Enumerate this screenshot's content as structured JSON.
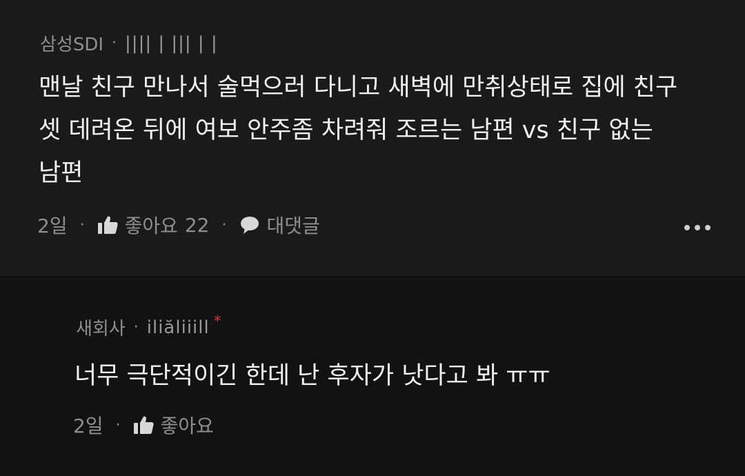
{
  "comment": {
    "author": "삼성SDI",
    "separator": "·",
    "handle": "|||| | ||| | |",
    "lines": [
      "맨날 친구 만나서 술먹으러 다니고 새벽에 만취상태로 집에 친구",
      "셋 데려온 뒤에 여보 안주좀 차려줘 조르는 남편 vs 친구 없는",
      "남편"
    ],
    "time": "2일",
    "like_label": "좋아요",
    "like_count": "22",
    "reply_label": "대댓글",
    "icons": {
      "like": "thumbs-up-icon",
      "reply": "speech-bubble-icon",
      "more": "more-dots-icon"
    }
  },
  "reply": {
    "author": "새회사",
    "separator": "·",
    "handle": "iliăliiill",
    "badge": "*",
    "text": "너무 극단적이긴 한데 난 후자가 낫다고 봐 ㅠㅠ",
    "time": "2일",
    "like_label": "좋아요"
  },
  "colors": {
    "background": "#131313",
    "main_comment_bg": "#1a1a1a",
    "text": "#f1f1f1",
    "muted": "#8f8f8f",
    "badge": "#e0303a"
  }
}
